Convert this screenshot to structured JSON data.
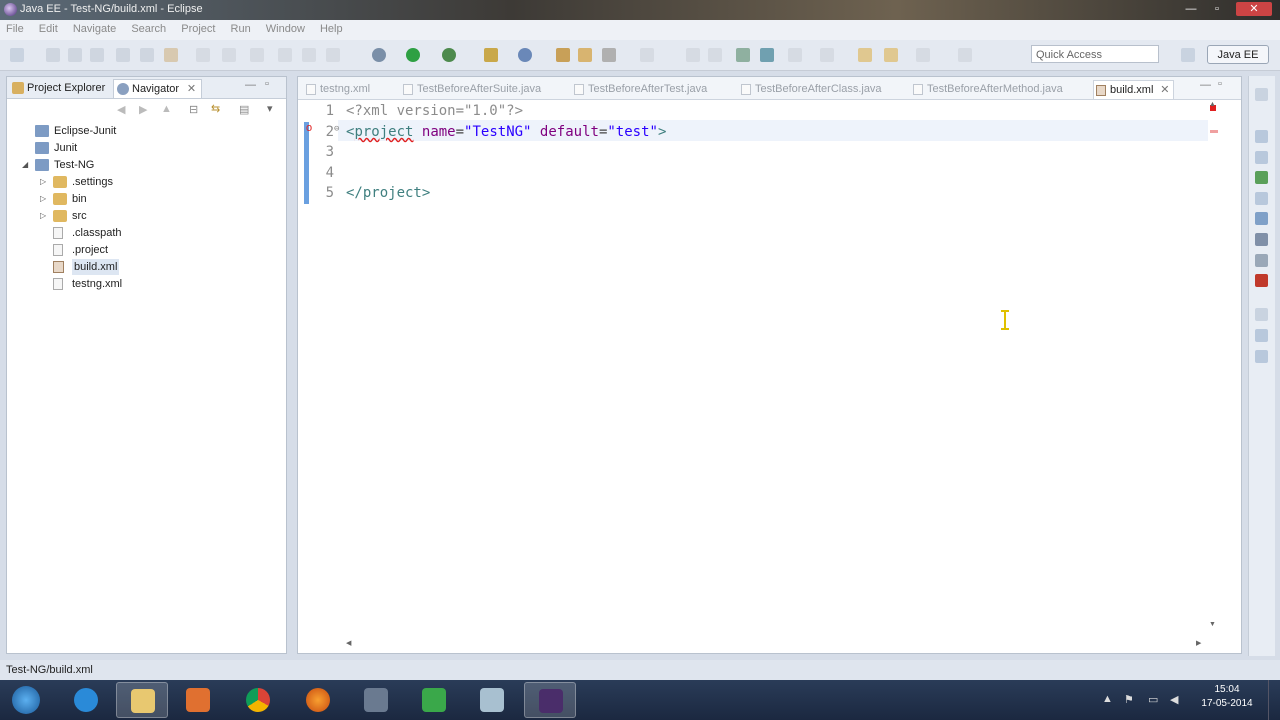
{
  "window": {
    "title": "Java EE - Test-NG/build.xml - Eclipse",
    "min": "—",
    "max": "▫",
    "close": "✕"
  },
  "menu": [
    "File",
    "Edit",
    "Navigate",
    "Search",
    "Project",
    "Run",
    "Window",
    "Help"
  ],
  "toolbar": {
    "quick_access": "Quick Access",
    "perspective": "Java EE"
  },
  "left_panel": {
    "tabs": [
      "Project Explorer",
      "Navigator"
    ],
    "tree": [
      {
        "label": "Eclipse-Junit",
        "kind": "project"
      },
      {
        "label": "Junit",
        "kind": "project"
      },
      {
        "label": "Test-NG",
        "kind": "project"
      },
      {
        "label": ".settings",
        "kind": "folder"
      },
      {
        "label": "bin",
        "kind": "folder"
      },
      {
        "label": "src",
        "kind": "folder"
      },
      {
        "label": ".classpath",
        "kind": "file"
      },
      {
        "label": ".project",
        "kind": "file"
      },
      {
        "label": "build.xml",
        "kind": "file"
      },
      {
        "label": "testng.xml",
        "kind": "file"
      }
    ]
  },
  "editor": {
    "tabs": [
      "testng.xml",
      "TestBeforeAfterSuite.java",
      "TestBeforeAfterTest.java",
      "TestBeforeAfterClass.java",
      "TestBeforeAfterMethod.java",
      "build.xml"
    ],
    "active_tab": "build.xml",
    "line_numbers": [
      "1",
      "2",
      "3",
      "4",
      "5"
    ],
    "line1": "<?xml version=\"1.0\"?>",
    "line2_open": "<",
    "line2_tag": "project",
    "line2_attr1": "name",
    "line2_eq1": "=",
    "line2_val1": "\"TestNG\"",
    "line2_attr2": "default",
    "line2_eq2": "=",
    "line2_val2": "\"test\"",
    "line2_close": ">",
    "line5": "</project>",
    "error_marker": "o",
    "fold_marker": "⊖"
  },
  "status_bar": {
    "path": "Test-NG/build.xml"
  },
  "taskbar": {
    "apps": [
      "start",
      "internet-explorer",
      "file-explorer",
      "media-player",
      "chrome",
      "firefox",
      "virtualbox",
      "spreadsheet",
      "notes",
      "eclipse"
    ],
    "clock_time": "15:04",
    "clock_date": "17-05-2014"
  },
  "colors": {
    "tag": "#3f7f7f",
    "attr": "#7f007f",
    "value": "#2a00ff",
    "accent": "#6aa0e0",
    "error": "#e02020"
  }
}
